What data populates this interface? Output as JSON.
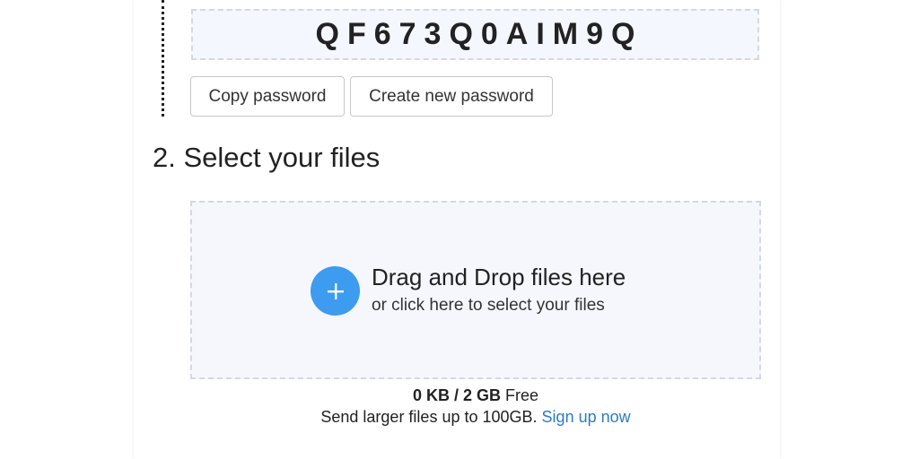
{
  "password": {
    "value": "QF673Q0AIM9Q",
    "copy_label": "Copy password",
    "create_label": "Create new password"
  },
  "files_section": {
    "title": "2. Select your files"
  },
  "dropzone": {
    "icon": "plus-icon",
    "main_text": "Drag and Drop files here",
    "sub_text": "or click here to select your files"
  },
  "quota": {
    "amount": "0 KB / 2 GB",
    "suffix": "Free"
  },
  "upsell": {
    "text": "Send larger files up to 100GB.",
    "link_label": "Sign up now"
  },
  "colors": {
    "accent": "#3d9bf0",
    "link": "#2b7cc6",
    "dropzone_bg": "#f5f7fd",
    "dashed_border": "#d4d8e0"
  }
}
